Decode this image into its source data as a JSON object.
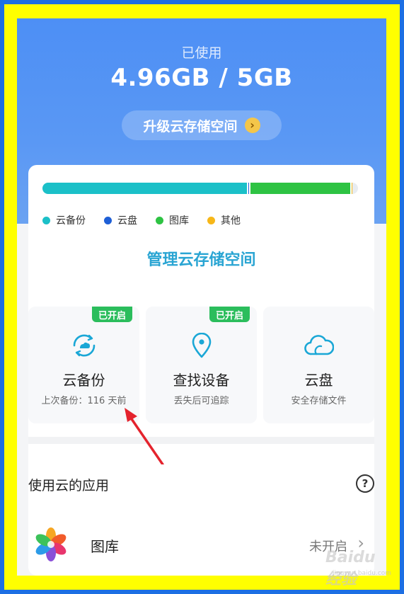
{
  "storage": {
    "used_label": "已使用",
    "used_value": "4.96GB / 5GB",
    "upgrade_label": "升级云存储空间",
    "bar": [
      {
        "name": "云备份",
        "fraction": 0.649,
        "color": "#1bc0c8"
      },
      {
        "name": "云盘",
        "fraction": 0.005,
        "color": "#1e5fd6"
      },
      {
        "name": "图库",
        "fraction": 0.322,
        "color": "#2ec343"
      },
      {
        "name": "其他",
        "fraction": 0.006,
        "color": "#f7b718"
      }
    ],
    "manage_label": "管理云存储空间"
  },
  "tiles": [
    {
      "title": "云备份",
      "subtitle": "上次备份：116 天前",
      "badge": "已开启",
      "icon": "cloud-backup-icon",
      "color": "#1aa7d6"
    },
    {
      "title": "查找设备",
      "subtitle": "丢失后可追踪",
      "badge": "已开启",
      "icon": "location-pin-icon",
      "color": "#1aa7d6"
    },
    {
      "title": "云盘",
      "subtitle": "安全存储文件",
      "badge": "",
      "icon": "cloud-icon",
      "color": "#1aa7d6"
    }
  ],
  "apps_section": {
    "title": "使用云的应用",
    "help_icon": "question-icon"
  },
  "apps": [
    {
      "name": "图库",
      "status": "未开启",
      "icon": "gallery-icon"
    }
  ],
  "watermark": {
    "text": "Baidu经验",
    "sub": "jingyan.baidu.com"
  }
}
